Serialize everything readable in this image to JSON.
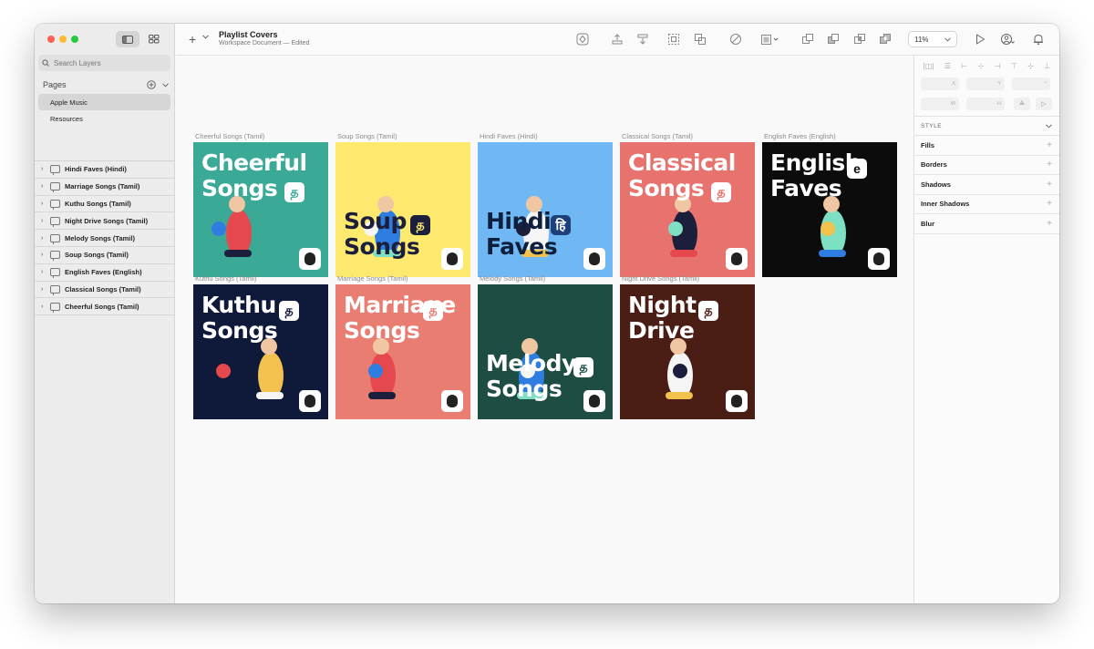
{
  "window": {
    "title": "Playlist Covers",
    "subtitle": "Workspace Document — Edited",
    "zoom": "11%"
  },
  "sidebar": {
    "search_placeholder": "Search Layers",
    "pages_label": "Pages",
    "pages": [
      "Apple Music",
      "Resources"
    ],
    "layers": [
      "Hindi Faves (Hindi)",
      "Marriage Songs (Tamil)",
      "Kuthu Songs (Tamil)",
      "Night Drive Songs (Tamil)",
      "Melody Songs (Tamil)",
      "Soup Songs (Tamil)",
      "English Faves (English)",
      "Classical Songs (Tamil)",
      "Cheerful Songs (Tamil)"
    ]
  },
  "artboards": [
    {
      "label": "Cheerful Songs (Tamil)",
      "line1": "Cheerful",
      "line2": "Songs",
      "badge": "த",
      "bg": "#3aa996",
      "text_color": "#ffffff",
      "badge_bg": "#ffffff",
      "badge_fg": "#3aa996"
    },
    {
      "label": "Soup Songs (Tamil)",
      "line1": "Soup",
      "line2": "Songs",
      "badge": "த",
      "bg": "#fde96e",
      "text_color": "#1b1f3b",
      "badge_bg": "#1b1f3b",
      "badge_fg": "#fde96e"
    },
    {
      "label": "Hindi Faves (Hindi)",
      "line1": "Hindi",
      "line2": "Faves",
      "badge": "हि",
      "bg": "#6fb8f4",
      "text_color": "#0e1f3d",
      "badge_bg": "#1d3f7a",
      "badge_fg": "#ffffff"
    },
    {
      "label": "Classical Songs (Tamil)",
      "line1": "Classical",
      "line2": "Songs",
      "badge": "த",
      "bg": "#e8736e",
      "text_color": "#ffffff",
      "badge_bg": "#ffffff",
      "badge_fg": "#e8736e"
    },
    {
      "label": "English Faves (English)",
      "line1": "English",
      "line2": "Faves",
      "badge": "e",
      "bg": "#0c0c0c",
      "text_color": "#ffffff",
      "badge_bg": "#ffffff",
      "badge_fg": "#0c0c0c"
    },
    {
      "label": "Kuthu Songs (Tamil)",
      "line1": "Kuthu",
      "line2": "Songs",
      "badge": "த",
      "bg": "#0f1a3a",
      "text_color": "#ffffff",
      "badge_bg": "#ffffff",
      "badge_fg": "#0f1a3a"
    },
    {
      "label": "Marriage Songs (Tamil)",
      "line1": "Marriage",
      "line2": "Songs",
      "badge": "த",
      "bg": "#ea7d72",
      "text_color": "#ffffff",
      "badge_bg": "#ffffff",
      "badge_fg": "#ea7d72"
    },
    {
      "label": "Melody Songs (Tamil)",
      "line1": "Melody",
      "line2": "Songs",
      "badge": "த",
      "bg": "#1e4d44",
      "text_color": "#ffffff",
      "badge_bg": "#ffffff",
      "badge_fg": "#1e4d44"
    },
    {
      "label": "Night Drive Songs (Tamil)",
      "line1": "Night",
      "line2": "Drive",
      "badge": "த",
      "bg": "#4a1e14",
      "text_color": "#ffffff",
      "badge_bg": "#ffffff",
      "badge_fg": "#4a1e14"
    }
  ],
  "inspector": {
    "fields": [
      "X",
      "Y",
      "°",
      "W",
      "H"
    ],
    "style_label": "STYLE",
    "sections": [
      "Fills",
      "Borders",
      "Shadows",
      "Inner Shadows",
      "Blur"
    ]
  },
  "icons": {
    "toolbar": [
      "create-symbol-icon",
      "forward-icon",
      "backward-icon",
      "group-icon",
      "ungroup-icon",
      "mask-icon",
      "scale-icon",
      "union-icon",
      "subtract-icon",
      "intersect-icon",
      "difference-icon",
      "preview-icon",
      "cloud-share-icon",
      "notifications-icon"
    ]
  }
}
